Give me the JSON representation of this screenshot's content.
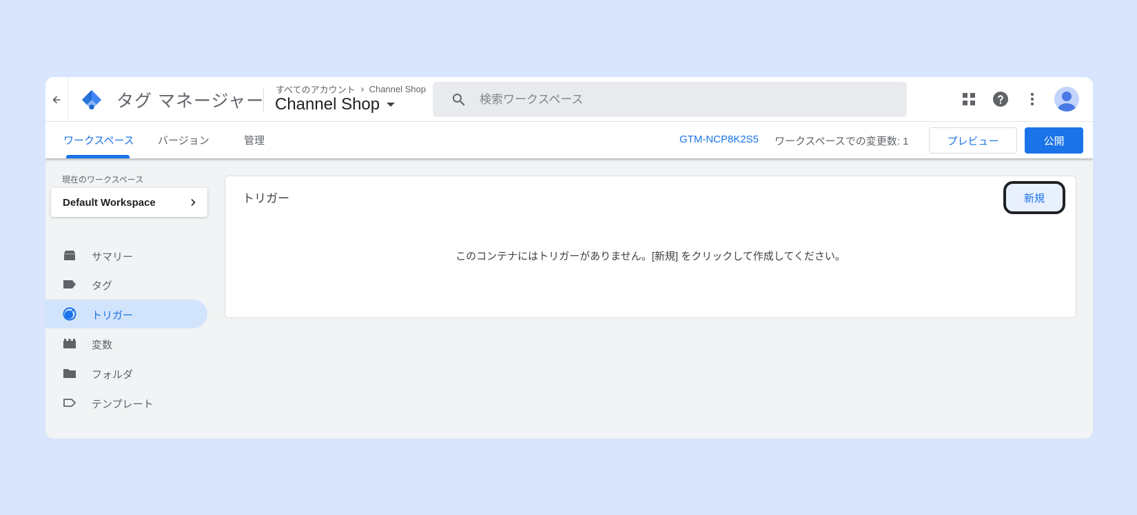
{
  "header": {
    "app_title": "タグ マネージャー",
    "breadcrumb_root": "すべてのアカウント",
    "breadcrumb_account": "Channel Shop",
    "container_name": "Channel Shop",
    "search_placeholder": "検索ワークスペース"
  },
  "tabs": [
    {
      "label": "ワークスペース",
      "active": true
    },
    {
      "label": "バージョン",
      "active": false
    },
    {
      "label": "管理",
      "active": false
    }
  ],
  "toolbar": {
    "container_id": "GTM-NCP8K2S5",
    "changes_label": "ワークスペースでの変更数: 1",
    "preview_label": "プレビュー",
    "publish_label": "公開"
  },
  "sidebar": {
    "current_workspace_label": "現在のワークスペース",
    "workspace_name": "Default Workspace",
    "items": [
      {
        "label": "サマリー",
        "icon": "overview-icon",
        "active": false
      },
      {
        "label": "タグ",
        "icon": "tag-icon",
        "active": false
      },
      {
        "label": "トリガー",
        "icon": "trigger-icon",
        "active": true
      },
      {
        "label": "変数",
        "icon": "variables-icon",
        "active": false
      },
      {
        "label": "フォルダ",
        "icon": "folder-icon",
        "active": false
      },
      {
        "label": "テンプレート",
        "icon": "template-icon",
        "active": false
      }
    ]
  },
  "main": {
    "title": "トリガー",
    "new_button_label": "新規",
    "empty_message": "このコンテナにはトリガーがありません。[新規] をクリックして作成してください。"
  },
  "colors": {
    "accent": "#1a73e8",
    "page_background": "#d8e5fc",
    "active_nav_background": "#d2e3fc"
  }
}
